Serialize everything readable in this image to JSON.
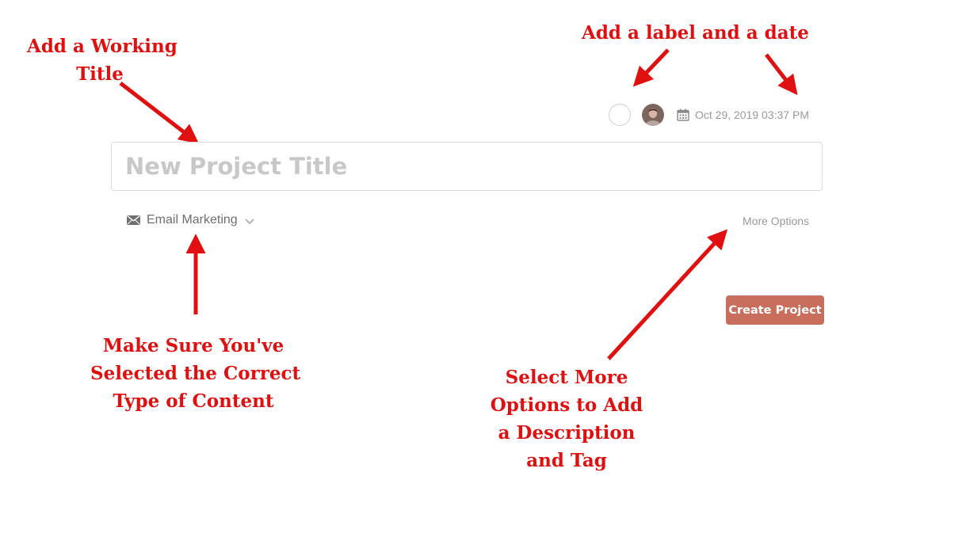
{
  "toolbar": {
    "label_picker_icon": "empty-circle-icon",
    "avatar_icon": "user-avatar",
    "calendar_icon": "calendar-icon",
    "date": "Oct 29, 2019 03:37 PM"
  },
  "form": {
    "title_placeholder": "New Project Title",
    "title_value": "",
    "content_type": {
      "icon": "envelope-icon",
      "label": "Email Marketing",
      "dropdown_icon": "chevron-down-icon"
    },
    "more_options_label": "More Options",
    "create_button_label": "Create Project"
  },
  "annotations": {
    "working_title": [
      "Add a Working",
      "Title"
    ],
    "label_date": [
      "Add a label and a date"
    ],
    "content_type": [
      "Make Sure You've",
      "Selected the Correct",
      "Type of Content"
    ],
    "more_options": [
      "Select More",
      "Options to Add",
      "a Description",
      "and Tag"
    ]
  },
  "colors": {
    "annotation": "#e01010",
    "primary_button": "#c96e5c",
    "muted_text": "#9a9a9a",
    "border": "#dcdcdc"
  }
}
